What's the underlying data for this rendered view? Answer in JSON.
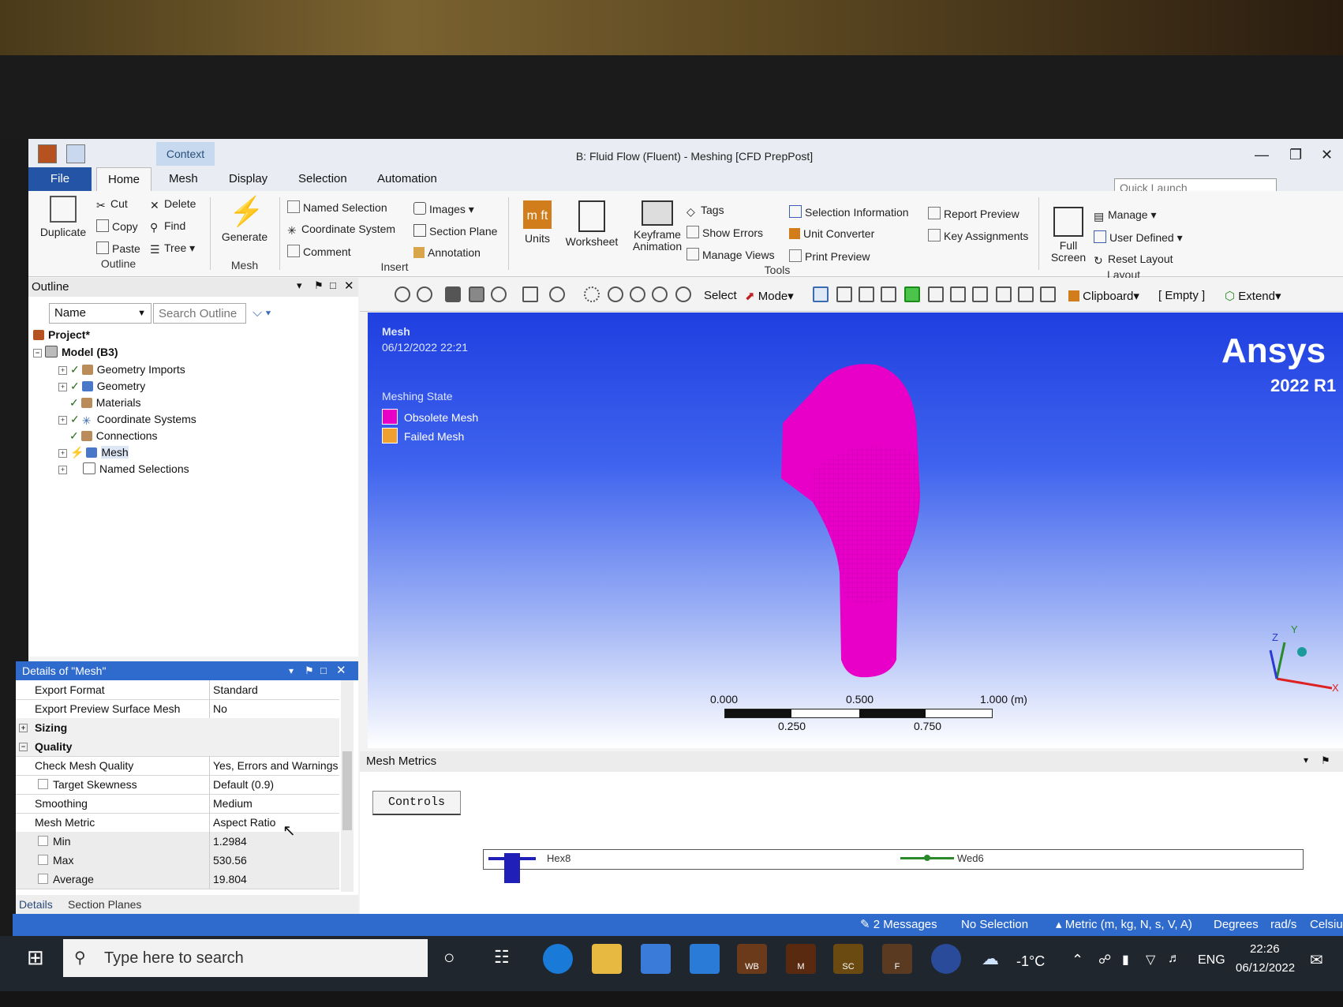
{
  "window": {
    "context_tab": "Context",
    "title": "B: Fluid Flow (Fluent) - Meshing [CFD PrepPost]",
    "quick_launch_placeholder": "Quick Launch"
  },
  "ribbon_tabs": [
    "File",
    "Home",
    "Mesh",
    "Display",
    "Selection",
    "Automation"
  ],
  "ribbon": {
    "outline_group": {
      "duplicate": "Duplicate",
      "cut": "Cut",
      "copy": "Copy",
      "paste": "Paste",
      "delete": "Delete",
      "find": "Find",
      "tree": "Tree",
      "label": "Outline"
    },
    "mesh_group": {
      "generate": "Generate",
      "label": "Mesh"
    },
    "insert_group": {
      "named_selection": "Named Selection",
      "coordinate_system": "Coordinate System",
      "comment": "Comment",
      "images": "Images",
      "section_plane": "Section Plane",
      "annotation": "Annotation",
      "label": "Insert"
    },
    "tools_group": {
      "units": "Units",
      "worksheet": "Worksheet",
      "keyframe_1": "Keyframe",
      "keyframe_2": "Animation",
      "tags": "Tags",
      "show_errors": "Show Errors",
      "manage_views": "Manage Views",
      "selection_information": "Selection Information",
      "unit_converter": "Unit Converter",
      "print_preview": "Print Preview",
      "report_preview": "Report Preview",
      "key_assignments": "Key Assignments",
      "label": "Tools"
    },
    "layout_group": {
      "full_1": "Full",
      "full_2": "Screen",
      "manage": "Manage",
      "user_defined": "User Defined",
      "reset_layout": "Reset Layout",
      "label": "Layout"
    }
  },
  "outline": {
    "title": "Outline",
    "filter_value": "Name",
    "search_placeholder": "Search Outline",
    "tree": [
      {
        "label": "Project*"
      },
      {
        "label": "Model (B3)"
      },
      {
        "label": "Geometry Imports"
      },
      {
        "label": "Geometry"
      },
      {
        "label": "Materials"
      },
      {
        "label": "Coordinate Systems"
      },
      {
        "label": "Connections"
      },
      {
        "label": "Mesh"
      },
      {
        "label": "Named Selections"
      }
    ]
  },
  "details": {
    "title": "Details of \"Mesh\"",
    "rows": [
      {
        "key": "Export Format",
        "value": "Standard"
      },
      {
        "key": "Export Preview Surface Mesh",
        "value": "No"
      },
      {
        "key": "Sizing",
        "value": ""
      },
      {
        "key": "Quality",
        "value": ""
      },
      {
        "key": "Check Mesh Quality",
        "value": "Yes, Errors and Warnings"
      },
      {
        "key": "Target Skewness",
        "value": "Default (0.9)"
      },
      {
        "key": "Smoothing",
        "value": "Medium"
      },
      {
        "key": "Mesh Metric",
        "value": "Aspect Ratio"
      },
      {
        "key": "Min",
        "value": "1.2984"
      },
      {
        "key": "Max",
        "value": "530.56"
      },
      {
        "key": "Average",
        "value": "19.804"
      }
    ],
    "tabs": [
      "Details",
      "Section Planes"
    ]
  },
  "graphics_toolbar": {
    "select": "Select",
    "mode": "Mode",
    "clipboard": "Clipboard",
    "empty": "[ Empty ]",
    "extend": "Extend"
  },
  "viewport": {
    "heading": "Mesh",
    "timestamp": "06/12/2022 22:21",
    "legend_title": "Meshing State",
    "legend": [
      {
        "label": "Obsolete Mesh",
        "color": "#e800c8"
      },
      {
        "label": "Failed Mesh",
        "color": "#f0a030"
      }
    ],
    "brand": "Ansys",
    "version": "2022 R1",
    "scale_top": [
      "0.000",
      "0.500",
      "1.000 (m)"
    ],
    "scale_bottom": [
      "0.250",
      "0.750"
    ],
    "axis": {
      "x": "X",
      "y": "Y",
      "z": "Z"
    }
  },
  "mesh_metrics": {
    "title": "Mesh Metrics",
    "controls": "Controls",
    "elements": [
      "Hex8",
      "Wed6"
    ]
  },
  "status": {
    "messages": "2 Messages",
    "selection": "No Selection",
    "units": "Metric (m, kg, N, s, V, A)",
    "angle": "Degrees",
    "rate": "rad/s",
    "temp": "Celsius"
  },
  "taskbar": {
    "search_placeholder": "Type here to search",
    "apps": [
      "WB",
      "M",
      "SC",
      "F"
    ],
    "temperature": "-1°C",
    "language": "ENG",
    "time": "22:26",
    "date": "06/12/2022"
  }
}
